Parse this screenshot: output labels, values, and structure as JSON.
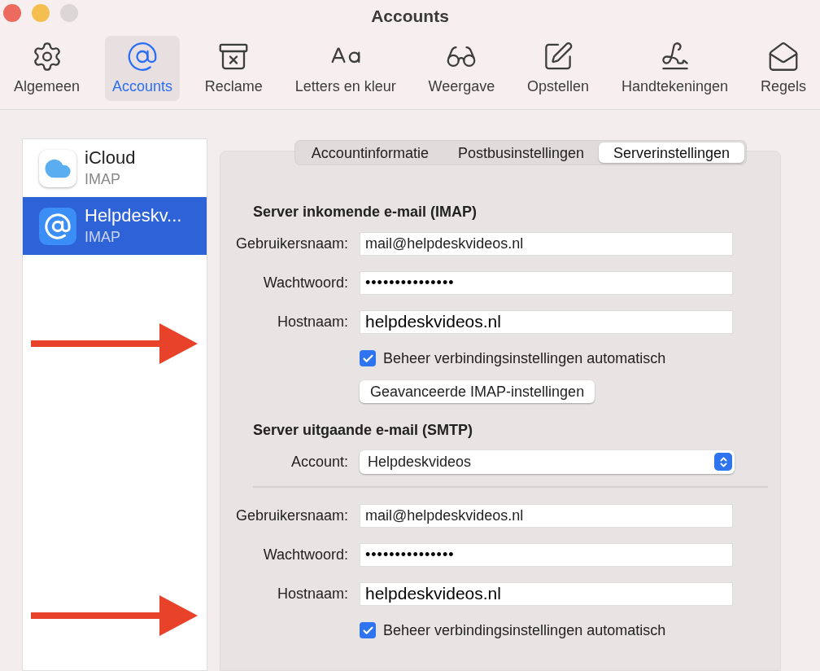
{
  "window": {
    "title": "Accounts"
  },
  "toolbar": [
    {
      "label": "Algemeen",
      "kind": "general",
      "selected": false
    },
    {
      "label": "Accounts",
      "kind": "accounts",
      "selected": true
    },
    {
      "label": "Reclame",
      "kind": "junk",
      "selected": false
    },
    {
      "label": "Letters en kleur",
      "kind": "fonts",
      "selected": false
    },
    {
      "label": "Weergave",
      "kind": "viewing",
      "selected": false
    },
    {
      "label": "Opstellen",
      "kind": "composing",
      "selected": false
    },
    {
      "label": "Handtekeningen",
      "kind": "signatures",
      "selected": false
    },
    {
      "label": "Regels",
      "kind": "rules",
      "selected": false
    }
  ],
  "accounts": [
    {
      "name": "iCloud",
      "type": "IMAP",
      "kind": "icloud",
      "selected": false
    },
    {
      "name": "Helpdeskv...",
      "type": "IMAP",
      "kind": "mail",
      "selected": true
    }
  ],
  "tabs": [
    {
      "label": "Accountinformatie",
      "selected": false
    },
    {
      "label": "Postbusinstellingen",
      "selected": false
    },
    {
      "label": "Serverinstellingen",
      "selected": true
    }
  ],
  "incoming": {
    "heading": "Server inkomende e-mail (IMAP)",
    "fields": [
      {
        "label": "Gebruikersnaam:",
        "value": "mail@helpdeskvideos.nl",
        "kind": "text"
      },
      {
        "label": "Wachtwoord:",
        "value": "•••••••••••••••",
        "kind": "password"
      },
      {
        "label": "Hostnaam:",
        "value": "helpdeskvideos.nl",
        "kind": "host"
      }
    ],
    "checkbox": {
      "label": "Beheer verbindingsinstellingen automatisch",
      "checked": true
    },
    "button": "Geavanceerde IMAP-instellingen"
  },
  "outgoing": {
    "heading": "Server uitgaande e-mail (SMTP)",
    "account": {
      "label": "Account:",
      "value": "Helpdeskvideos"
    },
    "fields": [
      {
        "label": "Gebruikersnaam:",
        "value": "mail@helpdeskvideos.nl",
        "kind": "text"
      },
      {
        "label": "Wachtwoord:",
        "value": "•••••••••••••••",
        "kind": "password"
      },
      {
        "label": "Hostnaam:",
        "value": "helpdeskvideos.nl",
        "kind": "host"
      }
    ],
    "checkbox": {
      "label": "Beheer verbindingsinstellingen automatisch",
      "checked": true
    }
  }
}
